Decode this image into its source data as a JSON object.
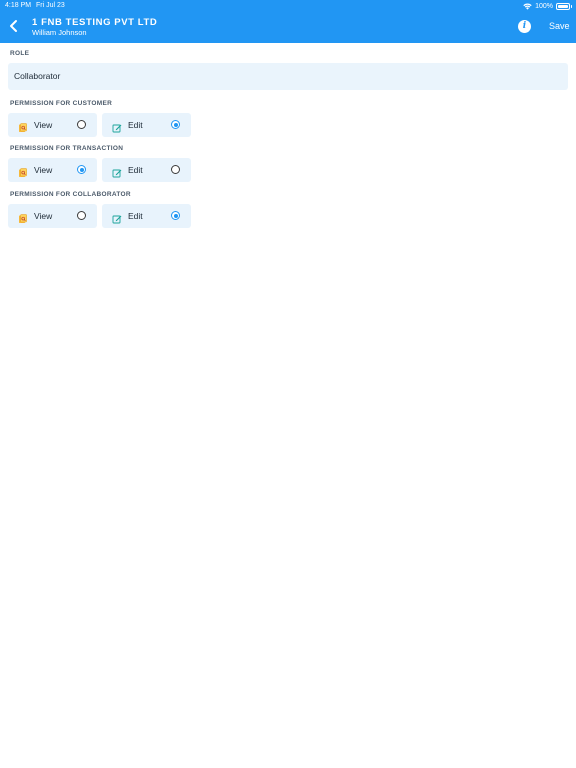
{
  "status_bar": {
    "time": "4:18 PM",
    "date": "Fri Jul 23",
    "battery": "100%",
    "battery_level": 1.0
  },
  "header": {
    "title": "1 FNB TESTING PVT LTD",
    "subtitle": "William Johnson",
    "save_label": "Save",
    "background_color": "#2196f3"
  },
  "role": {
    "label": "ROLE",
    "value": "Collaborator"
  },
  "permissions": [
    {
      "label": "PERMISSION FOR CUSTOMER",
      "view_label": "View",
      "edit_label": "Edit",
      "selected": "Edit"
    },
    {
      "label": "PERMISSION FOR TRANSACTION",
      "view_label": "View",
      "edit_label": "Edit",
      "selected": "View"
    },
    {
      "label": "PERMISSION FOR COLLABORATOR",
      "view_label": "View",
      "edit_label": "Edit",
      "selected": "Edit"
    }
  ],
  "icons": {
    "back": "chevron-left-icon",
    "info": "info-icon",
    "view": "view-document-icon",
    "edit": "edit-icon"
  },
  "colors": {
    "accent": "#2196f3",
    "option_bg": "#e8f3fc",
    "field_bg": "#eaf4fc"
  }
}
